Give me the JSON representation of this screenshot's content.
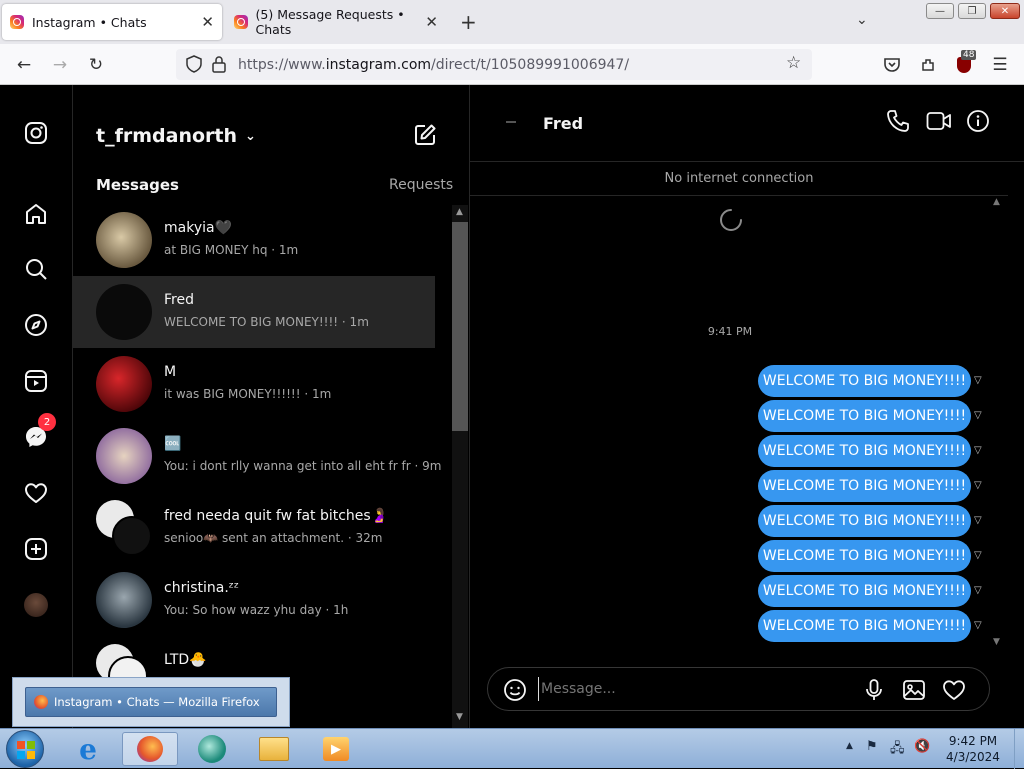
{
  "browser": {
    "tabs": [
      {
        "title": "Instagram • Chats",
        "active": true
      },
      {
        "title": "(5) Message Requests • Chats",
        "active": false
      }
    ],
    "url_prefix": "https://www.",
    "url_host": "instagram.com",
    "url_path": "/direct/t/105089991006947/",
    "extensions_badge": "48"
  },
  "rail": {
    "messenger_badge": "2",
    "icons": [
      "instagram-icon",
      "home-icon",
      "search-icon",
      "explore-icon",
      "reels-icon",
      "messenger-icon",
      "heart-icon",
      "create-icon",
      "profile-avatar",
      "more-icon"
    ]
  },
  "list": {
    "username": "t_frmdanorth",
    "messages_label": "Messages",
    "requests_label": "Requests",
    "conversations": [
      {
        "name": "makyia🖤",
        "preview": "at BIG MONEY hq · 1m",
        "avatar_color": "#8a7a5e"
      },
      {
        "name": "Fred",
        "preview": "WELCOME TO BIG MONEY!!!! · 1m",
        "avatar_color": "#0a0a0a",
        "selected": true
      },
      {
        "name": "M",
        "preview": "it was BIG MONEY!!!!!! · 1m",
        "avatar_color": "#8b0f14"
      },
      {
        "name": "🆒",
        "preview": "You: i dont rlly wanna get into all eht fr fr · 9m",
        "avatar_color": "#b98fa9"
      },
      {
        "name": "fred needa quit fw fat bitches🤰",
        "preview": "senioo🦇 sent an attachment. · 32m",
        "avatar_color": "#eaeaea"
      },
      {
        "name": "christina.ᶻᶻ",
        "preview": "You: So how wazz yhu day · 1h",
        "avatar_color": "#4c5a66"
      },
      {
        "name": "LTD🐣",
        "preview": "",
        "avatar_color": "#eaeaea"
      }
    ]
  },
  "chat": {
    "contact_name": "Fred",
    "connection_status": "No internet connection",
    "timestamp": "9:41 PM",
    "messages": [
      "WELCOME TO BIG MONEY!!!!",
      "WELCOME TO BIG MONEY!!!!",
      "WELCOME TO BIG MONEY!!!!",
      "WELCOME TO BIG MONEY!!!!",
      "WELCOME TO BIG MONEY!!!!",
      "WELCOME TO BIG MONEY!!!!",
      "WELCOME TO BIG MONEY!!!!",
      "WELCOME TO BIG MONEY!!!!"
    ],
    "input_placeholder": "Message...",
    "accent_color": "#3797f0"
  },
  "taskbar": {
    "preview_title": "Instagram • Chats — Mozilla Firefox",
    "clock_time": "9:42 PM",
    "clock_date": "4/3/2024"
  }
}
